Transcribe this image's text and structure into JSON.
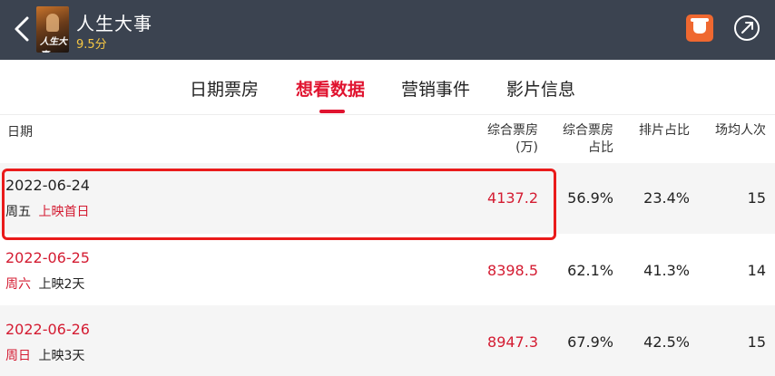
{
  "header": {
    "title": "人生大事",
    "score": "9.5分",
    "poster_text": "人生大事"
  },
  "tabs": [
    {
      "label": "日期票房",
      "active": false
    },
    {
      "label": "想看数据",
      "active": true
    },
    {
      "label": "营销事件",
      "active": false
    },
    {
      "label": "影片信息",
      "active": false
    }
  ],
  "table": {
    "columns": {
      "date": "日期",
      "box_office_line1": "综合票房",
      "box_office_line2": "(万)",
      "share_line1": "综合票房",
      "share_line2": "占比",
      "screening_share": "排片占比",
      "avg_per_show": "场均人次"
    },
    "rows": [
      {
        "date": "2022-06-24",
        "weekday": "周五",
        "release": "上映首日",
        "box_office": "4137.2",
        "share": "56.9%",
        "screening": "23.4%",
        "avg": "15"
      },
      {
        "date": "2022-06-25",
        "weekday": "周六",
        "release": "上映2天",
        "box_office": "8398.5",
        "share": "62.1%",
        "screening": "41.3%",
        "avg": "14"
      },
      {
        "date": "2022-06-26",
        "weekday": "周日",
        "release": "上映3天",
        "box_office": "8947.3",
        "share": "67.9%",
        "screening": "42.5%",
        "avg": "15"
      }
    ]
  },
  "colors": {
    "header_bg": "#3b4350",
    "accent_red": "#e0132f",
    "score_yellow": "#f6c744",
    "share_orange": "#ef6830",
    "highlight_border": "#ea1b1b"
  }
}
